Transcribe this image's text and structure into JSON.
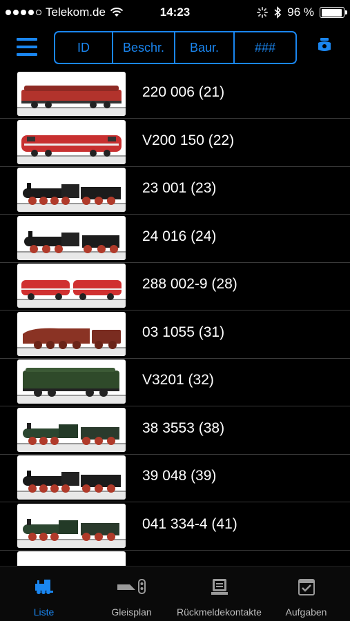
{
  "status_bar": {
    "carrier": "Telekom.de",
    "time": "14:23",
    "battery": "96 %",
    "battery_level": 0.96
  },
  "navbar": {
    "segments": [
      {
        "label": "ID",
        "active": false
      },
      {
        "label": "Beschr.",
        "active": false
      },
      {
        "label": "Baur.",
        "active": false
      },
      {
        "label": "###",
        "active": true
      }
    ]
  },
  "list": {
    "items": [
      {
        "label": "220 006 (21)",
        "loco": "diesel-red"
      },
      {
        "label": "V200 150 (22)",
        "loco": "diesel-red-v200"
      },
      {
        "label": "23 001 (23)",
        "loco": "steam-black"
      },
      {
        "label": "24 016 (24)",
        "loco": "steam-black-short"
      },
      {
        "label": "288 002-9 (28)",
        "loco": "diesel-red-double"
      },
      {
        "label": "03 1055 (31)",
        "loco": "steam-streamline-red"
      },
      {
        "label": "V3201 (32)",
        "loco": "diesel-green"
      },
      {
        "label": "38 3553 (38)",
        "loco": "steam-green"
      },
      {
        "label": "39 048 (39)",
        "loco": "steam-black"
      },
      {
        "label": "041 334-4 (41)",
        "loco": "steam-green-long"
      },
      {
        "label": "",
        "loco": "steam-black"
      }
    ]
  },
  "tabbar": {
    "tabs": [
      {
        "label": "Liste",
        "icon": "locomotive-icon",
        "active": true
      },
      {
        "label": "Gleisplan",
        "icon": "track-plan-icon",
        "active": false
      },
      {
        "label": "Rückmeldekontakte",
        "icon": "feedback-contacts-icon",
        "active": false
      },
      {
        "label": "Aufgaben",
        "icon": "tasks-icon",
        "active": false
      }
    ]
  },
  "colors": {
    "accent": "#1a86f0",
    "background": "#000000"
  }
}
